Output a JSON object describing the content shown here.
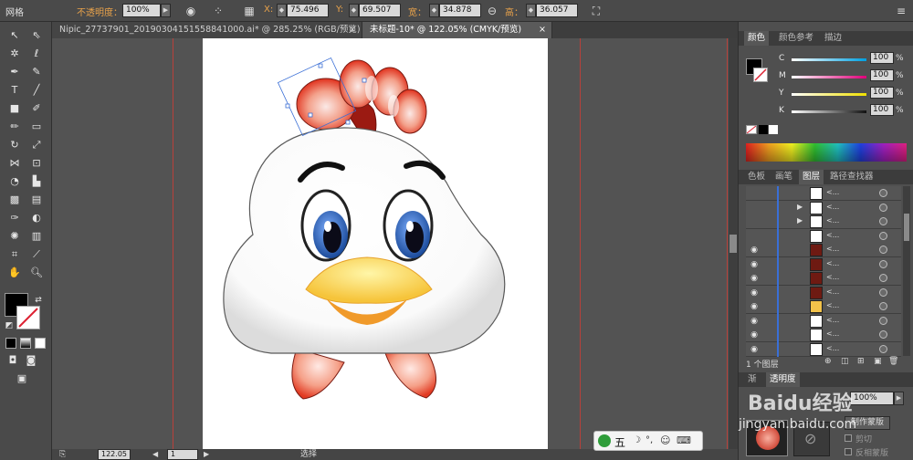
{
  "control_bar": {
    "mode_label": "网格",
    "opacity_label": "不透明度：",
    "opacity_value": "100%",
    "x_label": "X:",
    "x_value": "75.496",
    "y_label": "Y:",
    "y_value": "69.507",
    "w_label": "宽：",
    "w_value": "34.878",
    "h_label": "高：",
    "h_value": "36.057",
    "menu_glyph": "≡"
  },
  "tabs": [
    {
      "label": "Nipic_27737901_20190304151558841000.ai* @ 285.25% (RGB/预览)",
      "close": "×"
    },
    {
      "label": "未标题-10* @ 122.05% (CMYK/预览)",
      "close": "×"
    }
  ],
  "status_bar": {
    "zoom": "122.05",
    "page": "1",
    "tool_name": "选择"
  },
  "color_panel": {
    "tabs": [
      "颜色",
      "颜色参考",
      "描边"
    ],
    "sliders": [
      {
        "label": "C",
        "value": "100",
        "unit": "%"
      },
      {
        "label": "M",
        "value": "100",
        "unit": "%"
      },
      {
        "label": "Y",
        "value": "100",
        "unit": "%"
      },
      {
        "label": "K",
        "value": "100",
        "unit": "%"
      }
    ]
  },
  "layers_panel": {
    "tabs": [
      "色板",
      "画笔",
      "图层",
      "路径查找器"
    ],
    "footer": "1 个图层",
    "rows": [
      {
        "visible": false,
        "expand": false,
        "name": "<..."
      },
      {
        "visible": false,
        "expand": true,
        "name": "<..."
      },
      {
        "visible": false,
        "expand": true,
        "name": "<..."
      },
      {
        "visible": false,
        "expand": false,
        "name": "<..."
      },
      {
        "visible": true,
        "expand": false,
        "name": "<..."
      },
      {
        "visible": true,
        "expand": false,
        "name": "<..."
      },
      {
        "visible": true,
        "expand": false,
        "name": "<..."
      },
      {
        "visible": true,
        "expand": false,
        "name": "<..."
      },
      {
        "visible": true,
        "expand": false,
        "name": "<..."
      },
      {
        "visible": true,
        "expand": false,
        "name": "<..."
      },
      {
        "visible": true,
        "expand": false,
        "name": "<..."
      },
      {
        "visible": true,
        "expand": false,
        "name": "<..."
      }
    ]
  },
  "transparency_panel": {
    "tabs": [
      "渐",
      "透明度"
    ],
    "opacity": "100%",
    "make_mask": "制作蒙版",
    "clip": "剪切",
    "invert_mask": "反相蒙版"
  },
  "ime_bar": {
    "label": "五",
    "items": [
      "☽",
      "°,",
      "☺",
      "⌨"
    ]
  },
  "watermark": {
    "text": "Baidu经验",
    "url": "jingyan.baidu.com"
  },
  "colors": {
    "accent_orange": "#e8a24a",
    "guide_red": "#b8403a",
    "selection_blue": "#3a6fd6"
  }
}
